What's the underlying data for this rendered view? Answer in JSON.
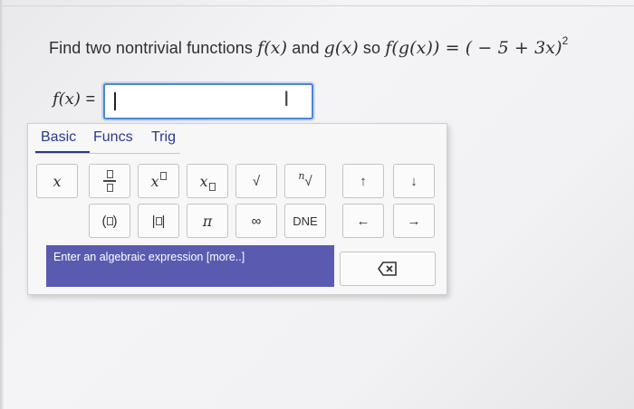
{
  "question": {
    "prefix": "Find two nontrivial functions",
    "f_of_x": "f(x)",
    "and": "and",
    "g_of_x": "g(x)",
    "so": "so",
    "composition": "f(g(x)) = ( − 5 + 3x)",
    "exponent": "2"
  },
  "answer": {
    "label": "f(x)",
    "equals": "=",
    "value": ""
  },
  "palette": {
    "tabs": [
      "Basic",
      "Funcs",
      "Trig"
    ],
    "active_tab": "Basic",
    "keys": {
      "variable": "x",
      "pi": "π",
      "infinity": "∞",
      "dne": "DNE",
      "up": "↑",
      "down": "↓",
      "left": "←",
      "right": "→",
      "sqrt": "√",
      "nthroot_n": "n",
      "nthroot_sym": "√"
    },
    "status_text": "Enter an algebraic expression [more..]"
  },
  "colors": {
    "accent": "#4a86d4",
    "tab_text": "#2a3a8c",
    "status_bg": "#5a5bb0"
  }
}
